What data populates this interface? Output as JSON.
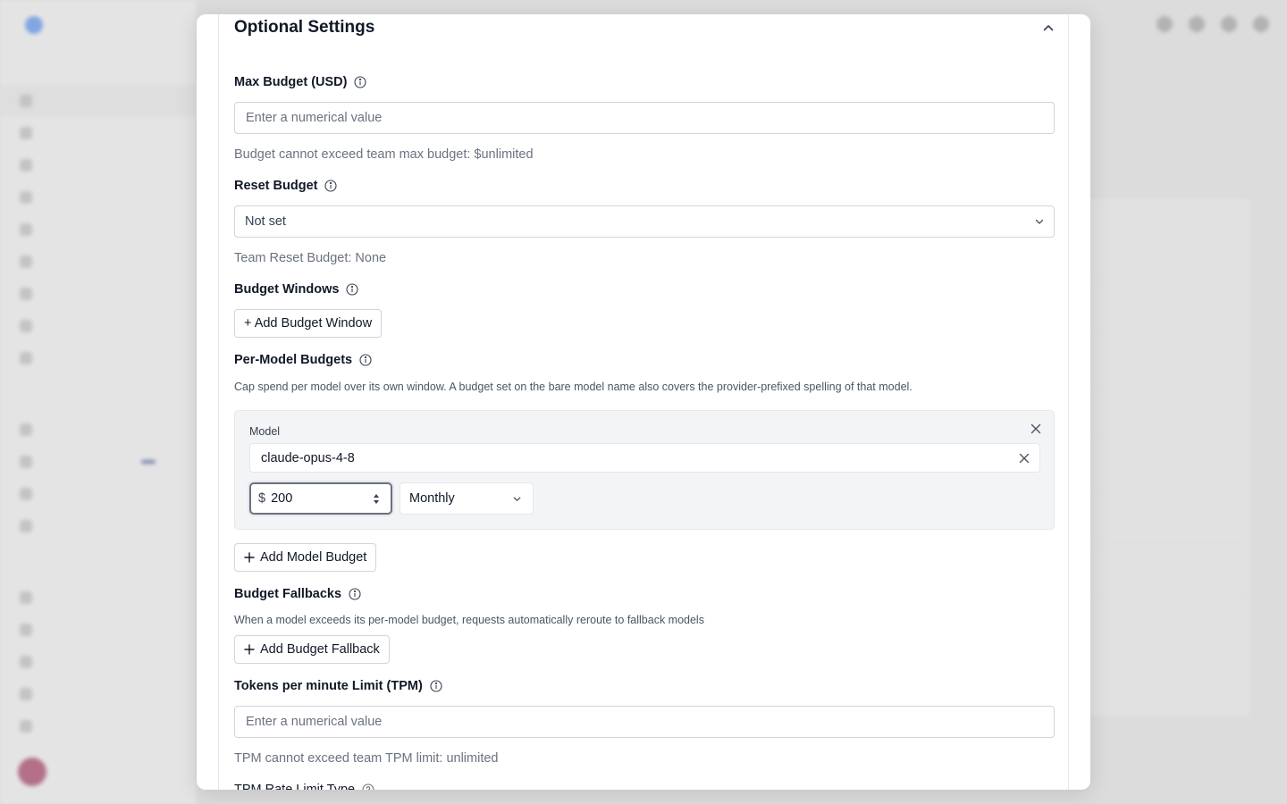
{
  "modal": {
    "section_title": "Optional Settings",
    "max_budget": {
      "label": "Max Budget (USD)",
      "placeholder": "Enter a numerical value",
      "helper": "Budget cannot exceed team max budget: $unlimited"
    },
    "reset_budget": {
      "label": "Reset Budget",
      "selected": "Not set",
      "helper": "Team Reset Budget: None"
    },
    "budget_windows": {
      "label": "Budget Windows",
      "add_button": "+ Add Budget Window"
    },
    "per_model_budgets": {
      "label": "Per-Model Budgets",
      "description": "Cap spend per model over its own window. A budget set on the bare model name also covers the provider-prefixed spelling of that model.",
      "entry": {
        "model_label": "Model",
        "model_value": "claude-opus-4-8",
        "currency": "$",
        "amount": "200",
        "period": "Monthly"
      },
      "add_button": "Add Model Budget"
    },
    "budget_fallbacks": {
      "label": "Budget Fallbacks",
      "description": "When a model exceeds its per-model budget, requests automatically reroute to fallback models",
      "add_button": "Add Budget Fallback"
    },
    "tpm_limit": {
      "label": "Tokens per minute Limit (TPM)",
      "placeholder": "Enter a numerical value",
      "helper": "TPM cannot exceed team TPM limit: unlimited"
    },
    "tpm_rate_limit_type": {
      "label": "TPM Rate Limit Type"
    }
  }
}
